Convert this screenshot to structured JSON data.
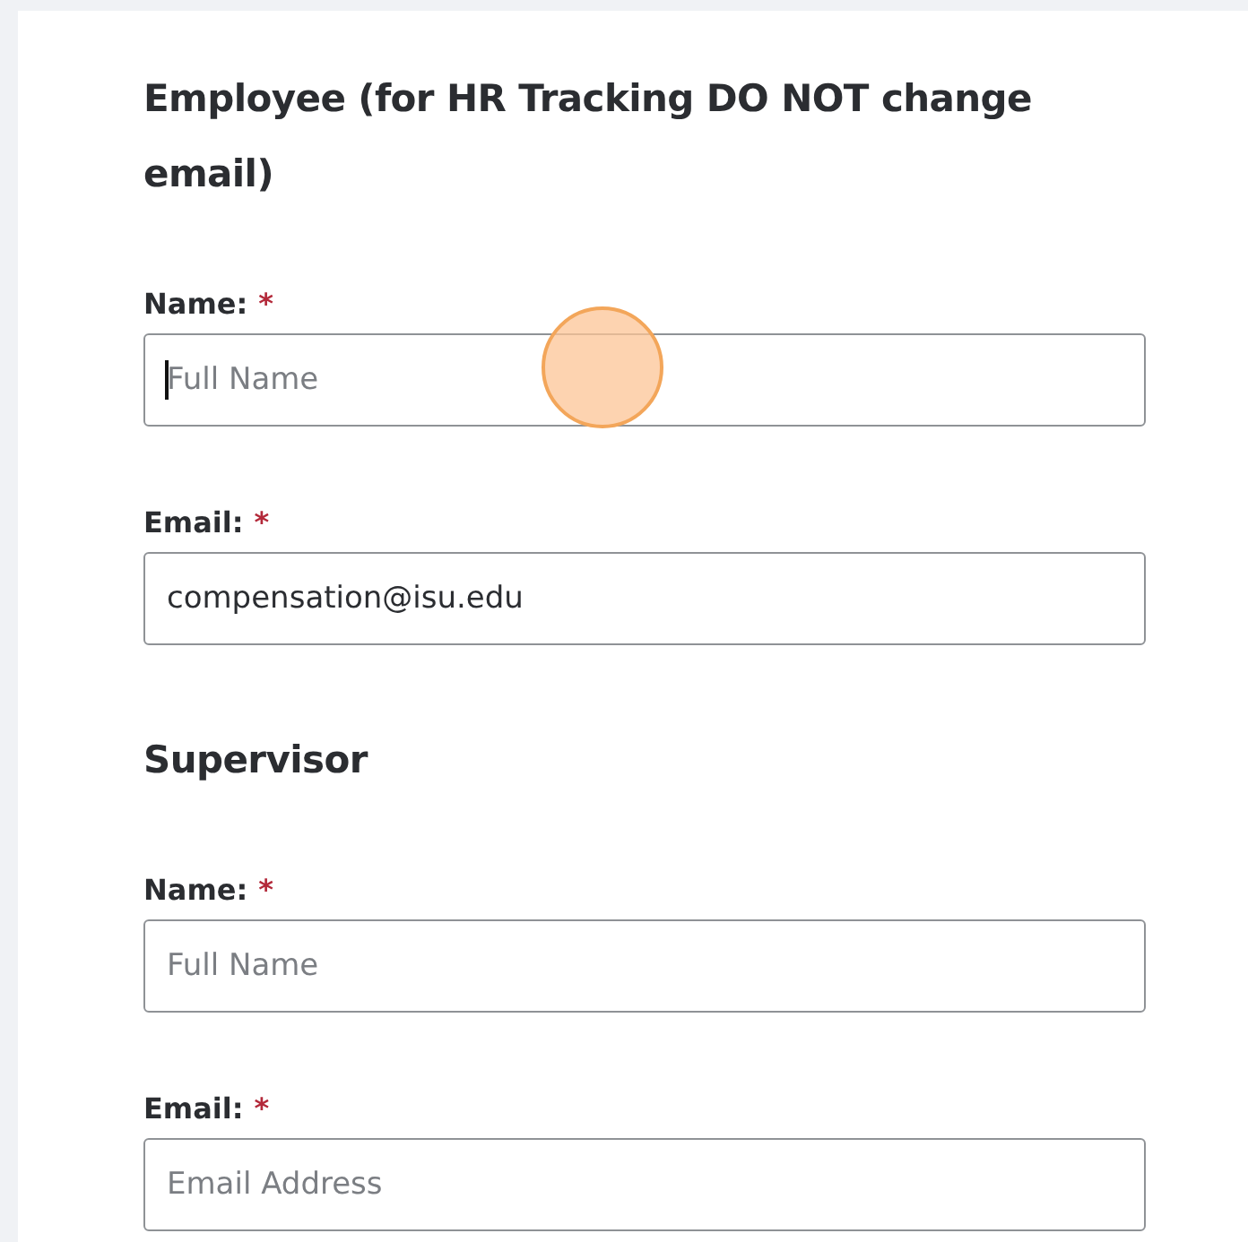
{
  "sections": [
    {
      "title": "Employee (for HR Tracking DO NOT change email)",
      "fields": [
        {
          "label": "Name:",
          "required_mark": "*",
          "placeholder": "Full Name",
          "focused": true
        },
        {
          "label": "Email:",
          "required_mark": "*",
          "value": "compensation@isu.edu",
          "focused": false
        }
      ]
    },
    {
      "title": "Supervisor",
      "fields": [
        {
          "label": "Name:",
          "required_mark": "*",
          "placeholder": "Full Name",
          "focused": false
        },
        {
          "label": "Email:",
          "required_mark": "*",
          "placeholder": "Email Address",
          "focused": false
        }
      ]
    }
  ]
}
